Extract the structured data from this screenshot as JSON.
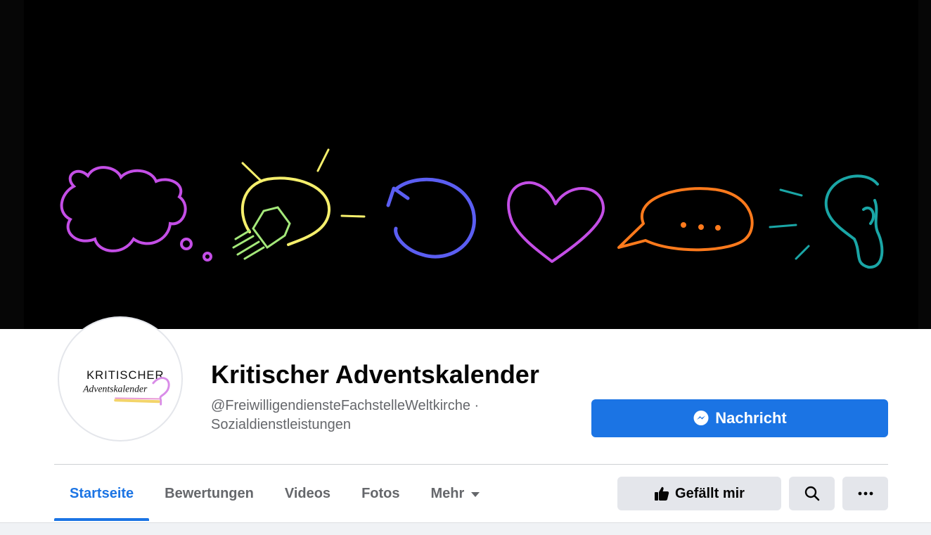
{
  "page": {
    "title": "Kritischer Adventskalender",
    "username": "@FreiwilligendiensteFachstelleWeltkirche",
    "separator": "·",
    "category": "Sozialdienstleistungen"
  },
  "avatar": {
    "line1": "KRITISCHER",
    "line2": "Adventskalender"
  },
  "actions": {
    "message_label": "Nachricht",
    "like_label": "Gefällt mir",
    "search_icon": "search-icon",
    "more_icon": "more-icon"
  },
  "tabs": [
    {
      "label": "Startseite",
      "active": true
    },
    {
      "label": "Bewertungen",
      "active": false
    },
    {
      "label": "Videos",
      "active": false
    },
    {
      "label": "Fotos",
      "active": false
    },
    {
      "label": "Mehr",
      "active": false
    }
  ],
  "colors": {
    "accent": "#1b74e4",
    "cover_bg": "#000000",
    "cloud": "#c44ee6",
    "bulb": "#f5ef6c",
    "bulb_base": "#a4e87a",
    "arrow_circle": "#5b5ef2",
    "heart": "#c44ee6",
    "speech": "#ff7a1c",
    "ear": "#1aa6a6"
  },
  "cover_icons": [
    "thought-cloud-icon",
    "light-bulb-icon",
    "refresh-circle-icon",
    "heart-icon",
    "speech-bubble-icon",
    "ear-icon"
  ]
}
